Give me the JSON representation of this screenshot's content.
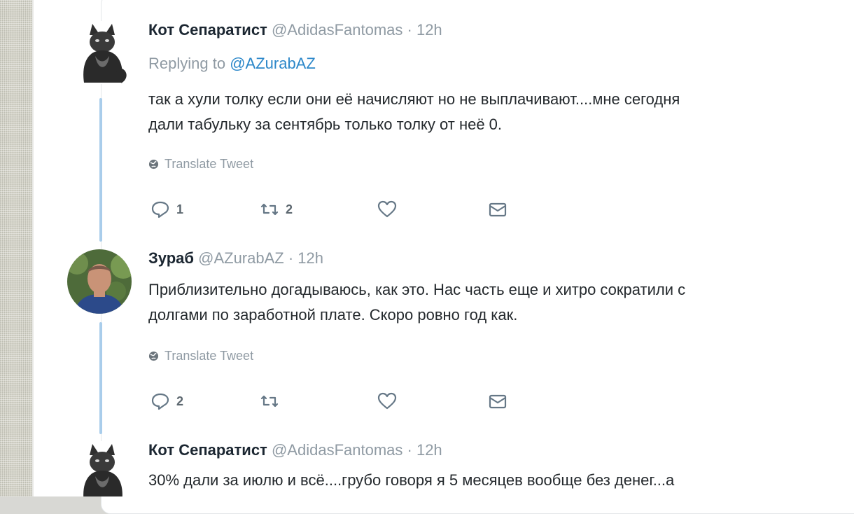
{
  "tweets": [
    {
      "name": "Кот Сепаратист",
      "handle": "@AdidasFantomas",
      "time": "· 12h",
      "replying_prefix": "Replying to",
      "replying_to": "@AZurabAZ",
      "line1": "так а хули толку если они её начисляют но не выплачивают....мне сегодня",
      "line2": "дали табульку за сентябрь только толку от неё 0.",
      "translate": "Translate Tweet",
      "replies": "1",
      "retweets": "2",
      "avatar_icon": "cat-avatar-icon"
    },
    {
      "name": "Зураб",
      "handle": "@AZurabAZ",
      "time": "· 12h",
      "line1": "Приблизительно догадываюсь, как это. Нас часть еще и хитро сократили с",
      "line2": "долгами по заработной плате. Скоро ровно год как.",
      "translate": "Translate Tweet",
      "replies": "2",
      "avatar_icon": "man-photo-avatar-icon"
    },
    {
      "name": "Кот Сепаратист",
      "handle": "@AdidasFantomas",
      "time": "· 12h",
      "line1": "30% дали за июлю и всё....грубо говоря я 5 месяцев вообще без денег...а",
      "avatar_icon": "cat-avatar-icon"
    }
  ],
  "colors": {
    "link": "#2b87c9",
    "muted": "#8f9aa3",
    "thread_line": "#a9cdeb",
    "text": "#24292d"
  }
}
